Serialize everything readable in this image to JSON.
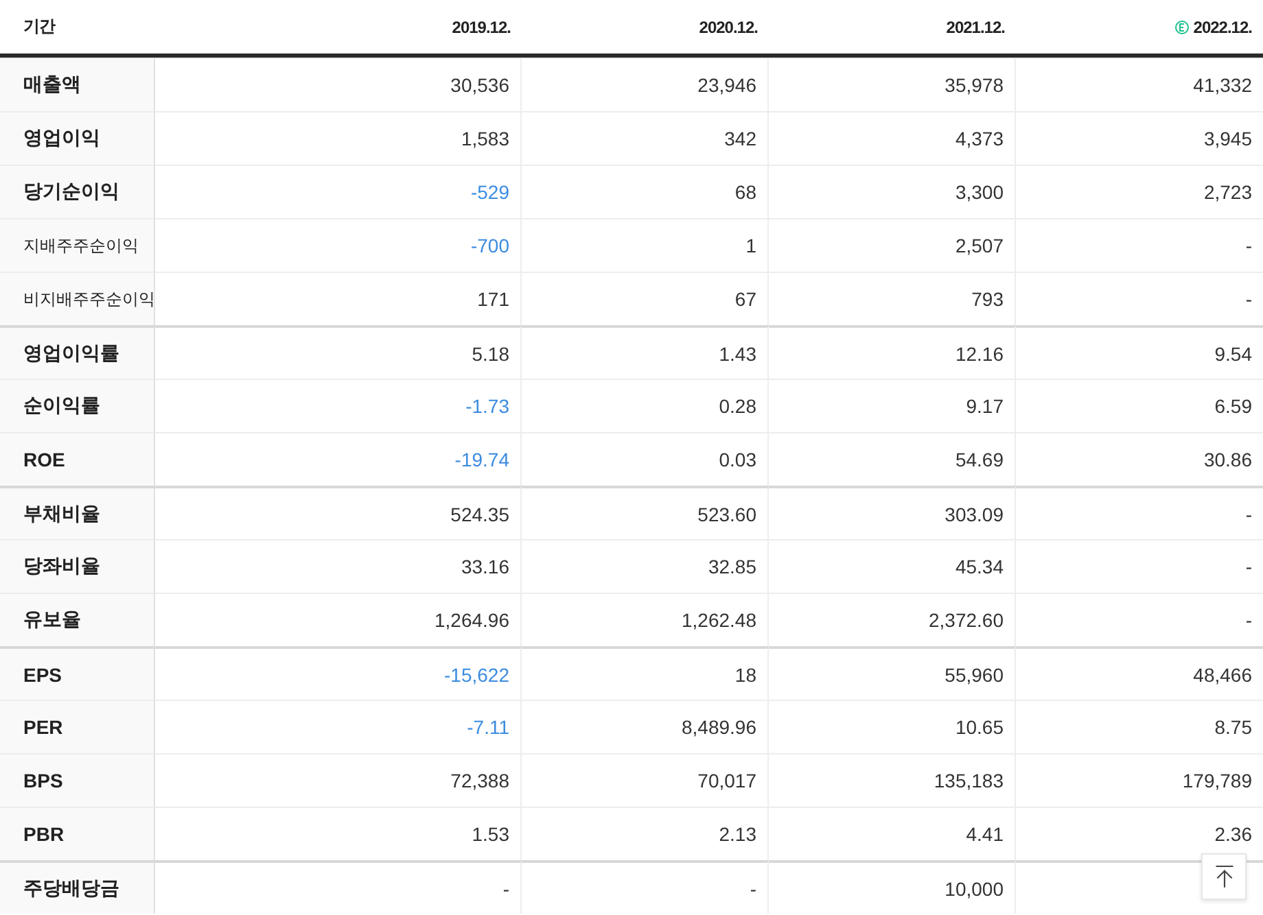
{
  "table": {
    "corner": "기간",
    "columns": [
      {
        "label": "2019.12.",
        "estimate": false
      },
      {
        "label": "2020.12.",
        "estimate": false
      },
      {
        "label": "2021.12.",
        "estimate": false
      },
      {
        "label": "2022.12.",
        "estimate": true
      }
    ],
    "rows": [
      {
        "label": "매출액",
        "kind": "main",
        "divider_above": false,
        "cells": [
          {
            "text": "30,536",
            "negative": false
          },
          {
            "text": "23,946",
            "negative": false
          },
          {
            "text": "35,978",
            "negative": false
          },
          {
            "text": "41,332",
            "negative": false
          }
        ]
      },
      {
        "label": "영업이익",
        "kind": "main",
        "divider_above": false,
        "cells": [
          {
            "text": "1,583",
            "negative": false
          },
          {
            "text": "342",
            "negative": false
          },
          {
            "text": "4,373",
            "negative": false
          },
          {
            "text": "3,945",
            "negative": false
          }
        ]
      },
      {
        "label": "당기순이익",
        "kind": "main",
        "divider_above": false,
        "cells": [
          {
            "text": "-529",
            "negative": true
          },
          {
            "text": "68",
            "negative": false
          },
          {
            "text": "3,300",
            "negative": false
          },
          {
            "text": "2,723",
            "negative": false
          }
        ]
      },
      {
        "label": "지배주주순이익",
        "kind": "sub",
        "divider_above": false,
        "cells": [
          {
            "text": "-700",
            "negative": true
          },
          {
            "text": "1",
            "negative": false
          },
          {
            "text": "2,507",
            "negative": false
          },
          {
            "text": "-",
            "negative": false
          }
        ]
      },
      {
        "label": "비지배주주순이익",
        "kind": "sub",
        "divider_above": false,
        "cells": [
          {
            "text": "171",
            "negative": false
          },
          {
            "text": "67",
            "negative": false
          },
          {
            "text": "793",
            "negative": false
          },
          {
            "text": "-",
            "negative": false
          }
        ]
      },
      {
        "label": "영업이익률",
        "kind": "main",
        "divider_above": true,
        "cells": [
          {
            "text": "5.18",
            "negative": false
          },
          {
            "text": "1.43",
            "negative": false
          },
          {
            "text": "12.16",
            "negative": false
          },
          {
            "text": "9.54",
            "negative": false
          }
        ]
      },
      {
        "label": "순이익률",
        "kind": "main",
        "divider_above": false,
        "cells": [
          {
            "text": "-1.73",
            "negative": true
          },
          {
            "text": "0.28",
            "negative": false
          },
          {
            "text": "9.17",
            "negative": false
          },
          {
            "text": "6.59",
            "negative": false
          }
        ]
      },
      {
        "label": "ROE",
        "kind": "main",
        "divider_above": false,
        "cells": [
          {
            "text": "-19.74",
            "negative": true
          },
          {
            "text": "0.03",
            "negative": false
          },
          {
            "text": "54.69",
            "negative": false
          },
          {
            "text": "30.86",
            "negative": false
          }
        ]
      },
      {
        "label": "부채비율",
        "kind": "main",
        "divider_above": true,
        "cells": [
          {
            "text": "524.35",
            "negative": false
          },
          {
            "text": "523.60",
            "negative": false
          },
          {
            "text": "303.09",
            "negative": false
          },
          {
            "text": "-",
            "negative": false
          }
        ]
      },
      {
        "label": "당좌비율",
        "kind": "main",
        "divider_above": false,
        "cells": [
          {
            "text": "33.16",
            "negative": false
          },
          {
            "text": "32.85",
            "negative": false
          },
          {
            "text": "45.34",
            "negative": false
          },
          {
            "text": "-",
            "negative": false
          }
        ]
      },
      {
        "label": "유보율",
        "kind": "main",
        "divider_above": false,
        "cells": [
          {
            "text": "1,264.96",
            "negative": false
          },
          {
            "text": "1,262.48",
            "negative": false
          },
          {
            "text": "2,372.60",
            "negative": false
          },
          {
            "text": "-",
            "negative": false
          }
        ]
      },
      {
        "label": "EPS",
        "kind": "main",
        "divider_above": true,
        "cells": [
          {
            "text": "-15,622",
            "negative": true
          },
          {
            "text": "18",
            "negative": false
          },
          {
            "text": "55,960",
            "negative": false
          },
          {
            "text": "48,466",
            "negative": false
          }
        ]
      },
      {
        "label": "PER",
        "kind": "main",
        "divider_above": false,
        "cells": [
          {
            "text": "-7.11",
            "negative": true
          },
          {
            "text": "8,489.96",
            "negative": false
          },
          {
            "text": "10.65",
            "negative": false
          },
          {
            "text": "8.75",
            "negative": false
          }
        ]
      },
      {
        "label": "BPS",
        "kind": "main",
        "divider_above": false,
        "cells": [
          {
            "text": "72,388",
            "negative": false
          },
          {
            "text": "70,017",
            "negative": false
          },
          {
            "text": "135,183",
            "negative": false
          },
          {
            "text": "179,789",
            "negative": false
          }
        ]
      },
      {
        "label": "PBR",
        "kind": "main",
        "divider_above": false,
        "cells": [
          {
            "text": "1.53",
            "negative": false
          },
          {
            "text": "2.13",
            "negative": false
          },
          {
            "text": "4.41",
            "negative": false
          },
          {
            "text": "2.36",
            "negative": false
          }
        ]
      },
      {
        "label": "주당배당금",
        "kind": "main",
        "divider_above": true,
        "cells": [
          {
            "text": "-",
            "negative": false
          },
          {
            "text": "-",
            "negative": false
          },
          {
            "text": "10,000",
            "negative": false
          }
        ]
      }
    ]
  }
}
